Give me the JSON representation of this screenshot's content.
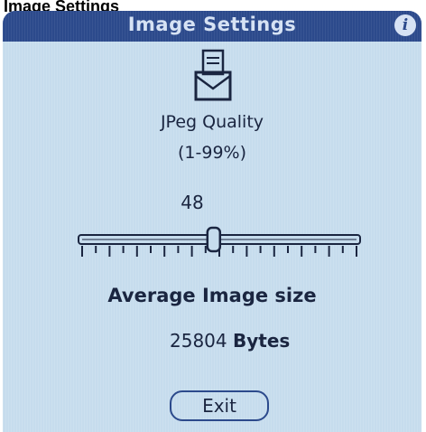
{
  "caption": "Image Settings",
  "titlebar": {
    "title": "Image Settings",
    "info_icon": "info-icon",
    "info_glyph": "i"
  },
  "app_icon": "envelope-icon",
  "quality": {
    "label": "JPeg Quality",
    "range_label": "(1-99%)",
    "value": "48",
    "min": 1,
    "max": 99,
    "slider_value": 48
  },
  "size": {
    "heading": "Average Image size",
    "value": "25804",
    "unit": "Bytes"
  },
  "exit_label": "Exit",
  "colors": {
    "screen": "#c6dced",
    "titlebar": "#2c4a8c",
    "text": "#1a2540"
  }
}
